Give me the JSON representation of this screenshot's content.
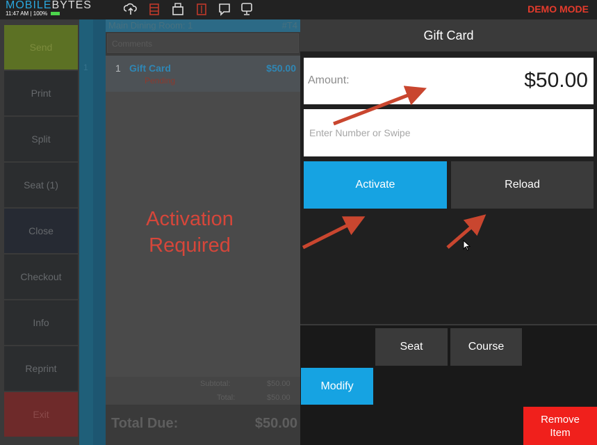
{
  "topbar": {
    "brand_part1": "MOBILE",
    "brand_part2": "BYTES",
    "time": "11:47 AM",
    "battery": "100%",
    "mode": "DEMO MODE",
    "icons": [
      "cloud-upload-icon",
      "server-icon",
      "printer-icon",
      "kitchen-icon",
      "chat-icon",
      "display-icon"
    ]
  },
  "sidebar": {
    "items": [
      {
        "label": "Send"
      },
      {
        "label": "Print"
      },
      {
        "label": "Split"
      },
      {
        "label": "Seat (1)"
      },
      {
        "label": "Close"
      },
      {
        "label": "Checkout"
      },
      {
        "label": "Info"
      },
      {
        "label": "Reprint"
      },
      {
        "label": "Exit"
      }
    ]
  },
  "ticket": {
    "title": "Main Dining Room: 1",
    "number": "#T4",
    "comments_placeholder": "Comments",
    "seat": "1",
    "items": [
      {
        "qty": "1",
        "name": "Gift Card",
        "price": "$50.00",
        "status": "Pending"
      }
    ],
    "subtotal_label": "Subtotal:",
    "subtotal_value": "$50.00",
    "total_label": "Total:",
    "total_value": "$50.00",
    "total_due_label": "Total Due:",
    "total_due_value": "$50.00"
  },
  "overlay": {
    "line1": "Activation",
    "line2": "Required"
  },
  "gift_card": {
    "title": "Gift Card",
    "amount_label": "Amount:",
    "amount_value": "$50.00",
    "card_input_value": "",
    "card_input_placeholder": "Enter Number or Swipe",
    "activate_label": "Activate",
    "reload_label": "Reload"
  },
  "actions": {
    "seat_label": "Seat",
    "course_label": "Course",
    "modify_label": "Modify",
    "remove_line1": "Remove",
    "remove_line2": "Item"
  },
  "colors": {
    "accent_blue": "#16a3e2",
    "danger_red": "#f0201c",
    "annotation_red": "#d6463a",
    "send_green": "#6e8a2a",
    "exit_red": "#7a2b2b"
  }
}
